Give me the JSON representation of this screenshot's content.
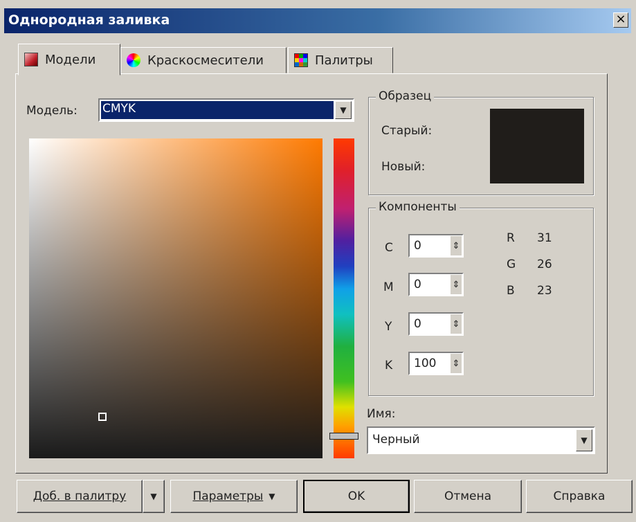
{
  "window": {
    "title": "Однородная заливка",
    "close": "×"
  },
  "tabs": [
    {
      "label": "Модели",
      "active": true,
      "icon": "models-icon"
    },
    {
      "label": "Краскосмесители",
      "active": false,
      "icon": "color-wheel-icon"
    },
    {
      "label": "Палитры",
      "active": false,
      "icon": "palette-grid-icon"
    }
  ],
  "model": {
    "label": "Модель:",
    "value": "CMYK"
  },
  "sample": {
    "title": "Образец",
    "old_label": "Старый:",
    "new_label": "Новый:",
    "color": "#201d1a"
  },
  "components": {
    "title": "Компоненты",
    "cmyk": [
      {
        "name": "C",
        "value": "0"
      },
      {
        "name": "M",
        "value": "0"
      },
      {
        "name": "Y",
        "value": "0"
      },
      {
        "name": "K",
        "value": "100"
      }
    ],
    "rgb": [
      {
        "name": "R",
        "value": "31"
      },
      {
        "name": "G",
        "value": "26"
      },
      {
        "name": "B",
        "value": "23"
      }
    ]
  },
  "name_field": {
    "label": "Имя:",
    "value": "Черный"
  },
  "buttons": {
    "add_to_palette": "Доб. в палитру",
    "params": "Параметры",
    "ok": "OK",
    "cancel": "Отмена",
    "help": "Справка"
  },
  "colors": {
    "hue": "#ff7a00",
    "title_start": "#0a246a",
    "title_end": "#a6caf0"
  }
}
